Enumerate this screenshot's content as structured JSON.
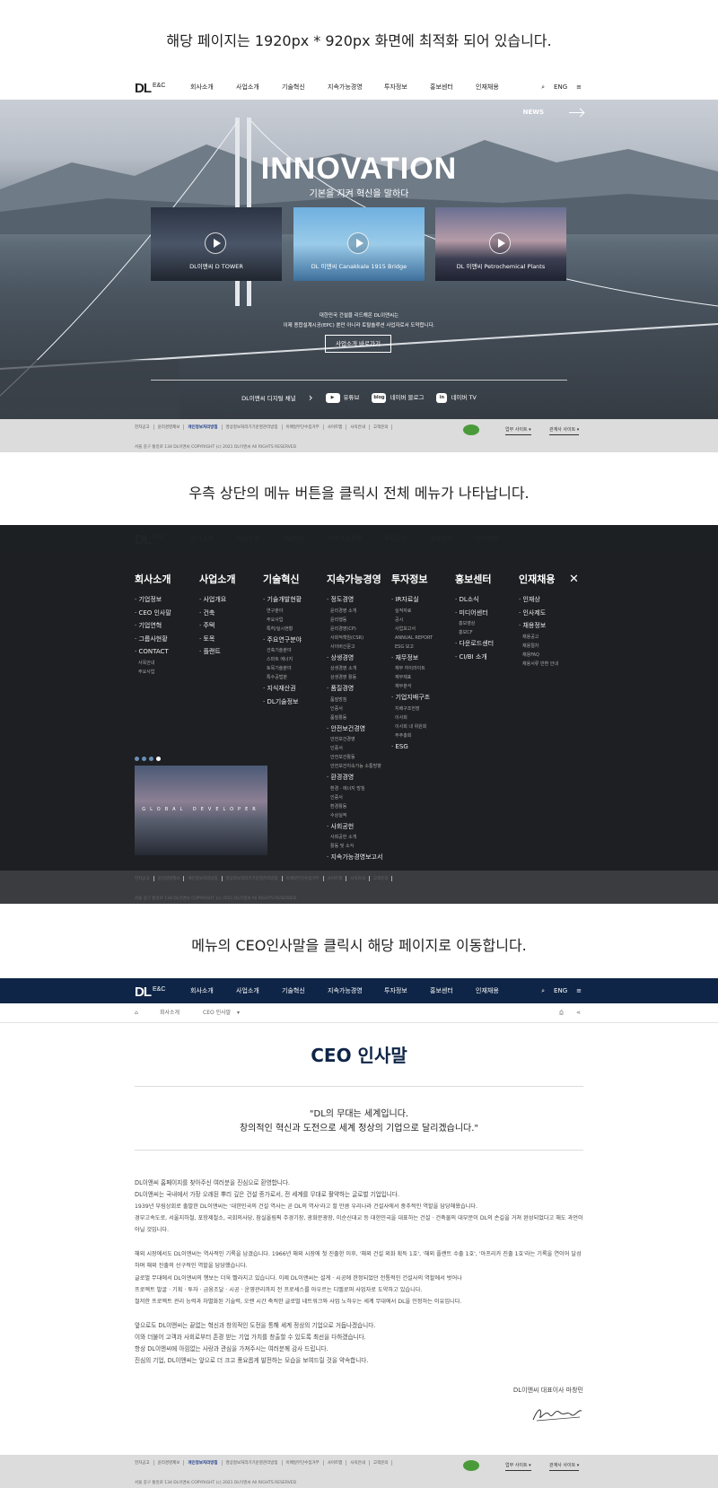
{
  "captions": {
    "c1": "해당 페이지는 1920px * 920px 화면에 최적화 되어 있습니다.",
    "c2": "우측 상단의 메뉴 버튼을 클릭시 전체 메뉴가 나타납니다.",
    "c3": "메뉴의 CEO인사말을 클릭시 해당 페이지로 이동합니다."
  },
  "header": {
    "logo": "DL",
    "logo_sub": "E&C",
    "nav": [
      "회사소개",
      "사업소개",
      "기술혁신",
      "지속가능경영",
      "투자정보",
      "홍보센터",
      "인재채용"
    ],
    "lang": "ENG",
    "search_icon": "search-icon",
    "menu_icon": "hamburger-menu-icon"
  },
  "hero": {
    "news": "NEWS",
    "title": "INNOVATION",
    "subtitle": "기본을 지켜 혁신을 말하다",
    "videos": [
      {
        "caption": "DL이앤씨 D TOWER"
      },
      {
        "caption": "DL 이앤씨 Canakkale 1915 Bridge"
      },
      {
        "caption": "DL 이앤씨 Petrochemical Plants"
      }
    ],
    "desc1": "대한민국 건설을 리드해온 DL이앤씨는",
    "desc2": "이제 종합설계시공(EPC) 뿐만 아니라 토탈솔루션 사업자로서 도약합니다.",
    "button": "사업소개 바로가기",
    "channels_label": "DL이앤씨 디지털 채널",
    "channels": [
      {
        "icon": "youtube-icon",
        "label": "유튜브"
      },
      {
        "icon": "blog-icon",
        "label": "네이버 블로그",
        "badge": "blog"
      },
      {
        "icon": "naver-tv-icon",
        "label": "네이버 TV",
        "badge": "in"
      }
    ]
  },
  "footer": {
    "links": [
      "전자공고",
      "윤리경영제보",
      "개인정보처리방침",
      "영상정보처리기기운영관리방침",
      "이메일무단수집거부",
      "사이트맵",
      "사옥안내",
      "고객문의"
    ],
    "copyright": "서울 중구 통일로 134 DL이앤씨 COPYRIGHT (c) 2021 DL이앤씨 All RIGHTS RESERVED",
    "family_site": "업무 사이트",
    "affiliate_site": "관계사 사이트"
  },
  "menu": {
    "columns": [
      {
        "title": "회사소개",
        "items": [
          {
            "label": "· 기업정보"
          },
          {
            "label": "· CEO 인사말"
          },
          {
            "label": "· 기업연혁"
          },
          {
            "label": "· 그룹사현황"
          },
          {
            "label": "· CONTACT",
            "subs": [
              "사옥안내",
              "주요사업"
            ]
          }
        ]
      },
      {
        "title": "사업소개",
        "items": [
          {
            "label": "· 사업개요"
          },
          {
            "label": "· 건축"
          },
          {
            "label": "· 주택"
          },
          {
            "label": "· 토목"
          },
          {
            "label": "· 플랜트"
          }
        ]
      },
      {
        "title": "기술혁신",
        "items": [
          {
            "label": "· 기술개발현황",
            "subs": [
              "연구분야",
              "주요사업",
              "특허/실시현황"
            ]
          },
          {
            "label": "· 주요연구분야",
            "subs": [
              "건축기술분야",
              "스마트 에너지",
              "토목기술분야",
              "특수공법분"
            ]
          },
          {
            "label": "· 지식재산권"
          },
          {
            "label": "· DL기술정보"
          }
        ]
      },
      {
        "title": "지속가능경영",
        "items": [
          {
            "label": "· 정도경영",
            "subs": [
              "윤리경영 소개",
              "윤리행동",
              "윤리경영(CP)",
              "사회적책임(CSR)",
              "사이버신문고"
            ]
          },
          {
            "label": "· 상생경영",
            "subs": [
              "상생경영 소개",
              "상생경영 활동"
            ]
          },
          {
            "label": "· 품질경영",
            "subs": [
              "품질방침",
              "인증서",
              "품질활동"
            ]
          },
          {
            "label": "· 안전보건경영",
            "subs": [
              "안전보건경영",
              "인증서",
              "안전보건활동",
              "안전보건지속가능 소통방향"
            ]
          },
          {
            "label": "· 환경경영",
            "subs": [
              "환경 · 에너지 방침",
              "인증서",
              "환경활동",
              "수상실적"
            ]
          },
          {
            "label": "· 사회공헌",
            "subs": [
              "사회공헌 소개",
              "활동 및 소식"
            ]
          },
          {
            "label": "· 지속가능경영보고서"
          }
        ]
      },
      {
        "title": "투자정보",
        "items": [
          {
            "label": "· IR자료실",
            "subs": [
              "실적자료",
              "공시",
              "사업보고서",
              "ANNUAL REPORT",
              "ESG 보고"
            ]
          },
          {
            "label": "· 재무정보",
            "subs": [
              "재무 하이라이트",
              "재무제표",
              "재무분석"
            ]
          },
          {
            "label": "· 기업지배구조",
            "subs": [
              "지배구조헌장",
              "이사회",
              "이사회 내 위원회",
              "주주총회"
            ]
          },
          {
            "label": "· ESG"
          }
        ]
      },
      {
        "title": "홍보센터",
        "items": [
          {
            "label": "· DL소식"
          },
          {
            "label": "· 미디어센터",
            "subs": [
              "홍보영상",
              "홍보CF"
            ]
          },
          {
            "label": "· 다운로드센터"
          },
          {
            "label": "· CI/BI 소개"
          }
        ]
      },
      {
        "title": "인재채용",
        "items": [
          {
            "label": "· 인재상"
          },
          {
            "label": "· 인사제도"
          },
          {
            "label": "· 채용정보",
            "subs": [
              "채용공고",
              "채용절차",
              "채용FAQ",
              "채용서류 반환 안내"
            ]
          }
        ]
      }
    ],
    "close_icon": "close-icon",
    "promo": "GLOBAL DEVELOPER"
  },
  "ceo": {
    "breadcrumb": [
      "회사소개",
      "CEO 인사말"
    ],
    "title": "CEO 인사말",
    "quote1": "\"DL의 무대는 세계입니다.",
    "quote2": "창의적인 혁신과 도전으로 세계 정상의 기업으로 달리겠습니다.\"",
    "paragraphs": [
      "DL이앤씨 홈페이지를 찾아주신 여러분을 진심으로 환영합니다.",
      "DL이앤씨는 국내에서 가장 오래된 뿌리 깊은 건설 종가로서, 전 세계를 무대로 활약하는 글로벌 기업입니다.",
      "1939년 부림상회로 출발한 DL이앤씨는 '대한민국의 건설 역사는 곧 DL의 역사'라고 할 만큼 우리나라 건설사에서 중추적인 역할을 담당해왔습니다.",
      "경부고속도로, 서울지하철, 포항제철소, 국회의사당, 잠실올림픽 주경기장, 광화문광장, 이순신대교 등 대한민국을 대표하는 건설 · 건축물의 대부분이 DL의 손길을 거쳐 완성되었다고 해도 과언이 아닐 것입니다.",
      "해외 시장에서도 DL이앤씨는 역사적인 기록을 남겼습니다. 1966년 해외 시장에 첫 진출한 이후, '해외 건설 외화 획득 1호', '해외 플랜트 수출 1호', '아프리카 진출 1호'라는 기록을 연이어 달성하며 해외 진출의 선구적인 역할을 담당했습니다.",
      "글로벌 무대에서 DL이앤씨의 행보는 더욱 빨라지고 있습니다. 이제 DL이앤씨는 설계 · 시공에 한정되었던 전통적인 건설사의 역할에서 벗어나",
      "프로젝트 발굴 · 기획 · 투자 · 금융조달 · 시공 · 운영관리까지 전 프로세스를 아우르는 디벨로퍼 사업자로 도약하고 있습니다.",
      "철저한 프로젝트 관리 능력과 차별화된 기술력, 오랜 시간 축적한 글로벌 네트워크와 사업 노하우는 세계 무대에서 DL을 인정하는 이유입니다.",
      "앞으로도 DL이앤씨는 끝없는 혁신과 창의적인 도전을 통해 세계 정상의 기업으로 거듭나겠습니다.",
      "이와 더불어 고객과 사회로부터 존경 받는 기업 가치를 창출할 수 있도록 최선을 다하겠습니다.",
      "항상 DL이앤씨에 아낌없는 사랑과 관심을 가져주시는 여러분께 감사 드립니다.",
      "진심의 기업, DL이앤씨는 앞으로 더 크고 풍요롭게 발전하는 모습을 보여드릴 것을 약속합니다."
    ],
    "signer": "DL이앤씨 대표이사 마창민",
    "print_icon": "print-icon",
    "share_icon": "share-icon",
    "home_icon": "home-icon"
  },
  "colors": {
    "navy": "#0f2547",
    "accent": "#1a3a8a"
  }
}
